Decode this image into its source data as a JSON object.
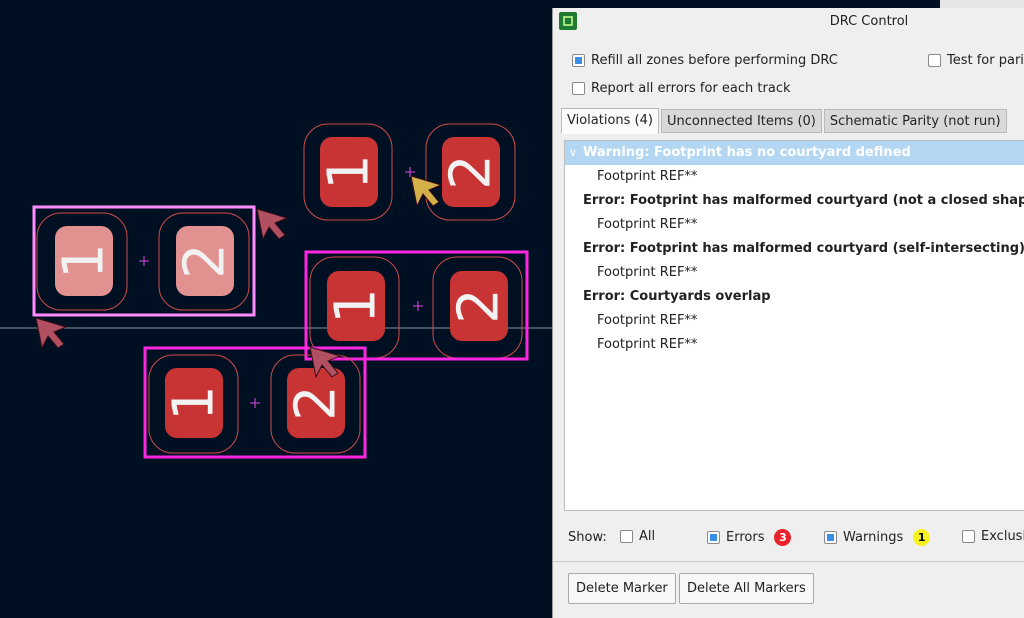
{
  "pcb": {
    "background": "#001023",
    "pad_color": "#c83434",
    "pad_highlight_color": "#e29191",
    "courtyard_color": "#ff26e2",
    "selection_color": "#ff8cff",
    "marker_error_color": "#b05060",
    "marker_warning_color": "#d4b04a",
    "footprints": [
      {
        "pads": [
          "1",
          "2"
        ],
        "highlighted": true
      },
      {
        "pads": [
          "1",
          "2"
        ],
        "highlighted": false
      },
      {
        "pads": [
          "1",
          "2"
        ],
        "highlighted": false
      },
      {
        "pads": [
          "1",
          "2"
        ],
        "highlighted": false
      }
    ]
  },
  "dialog": {
    "title": "DRC Control",
    "options": {
      "refill_zones": {
        "label": "Refill all zones before performing DRC",
        "checked": true
      },
      "test_parity": {
        "label": "Test for parity",
        "checked": false
      },
      "report_all_errors": {
        "label": "Report all errors for each track",
        "checked": false
      }
    },
    "tabs": [
      {
        "label": "Violations (4)",
        "active": true
      },
      {
        "label": "Unconnected Items (0)",
        "active": false
      },
      {
        "label": "Schematic Parity (not run)",
        "active": false
      }
    ],
    "violations": [
      {
        "title": "Warning: Footprint has no courtyard defined",
        "severity": "warning",
        "selected": true,
        "items": [
          "Footprint REF**"
        ]
      },
      {
        "title": "Error: Footprint has malformed courtyard (not a closed shape)",
        "severity": "error",
        "selected": false,
        "items": [
          "Footprint REF**"
        ]
      },
      {
        "title": "Error: Footprint has malformed courtyard (self-intersecting)",
        "severity": "error",
        "selected": false,
        "items": [
          "Footprint REF**"
        ]
      },
      {
        "title": "Error: Courtyards overlap",
        "severity": "error",
        "selected": false,
        "items": [
          "Footprint REF**",
          "Footprint REF**"
        ]
      }
    ],
    "show": {
      "label": "Show:",
      "all": {
        "label": "All",
        "checked": false
      },
      "errors": {
        "label": "Errors",
        "checked": true,
        "count": "3"
      },
      "warnings": {
        "label": "Warnings",
        "checked": true,
        "count": "1"
      },
      "exclusions": {
        "label": "Exclusions",
        "checked": false
      }
    },
    "buttons": {
      "delete_marker": "Delete Marker",
      "delete_all_markers": "Delete All Markers"
    }
  }
}
